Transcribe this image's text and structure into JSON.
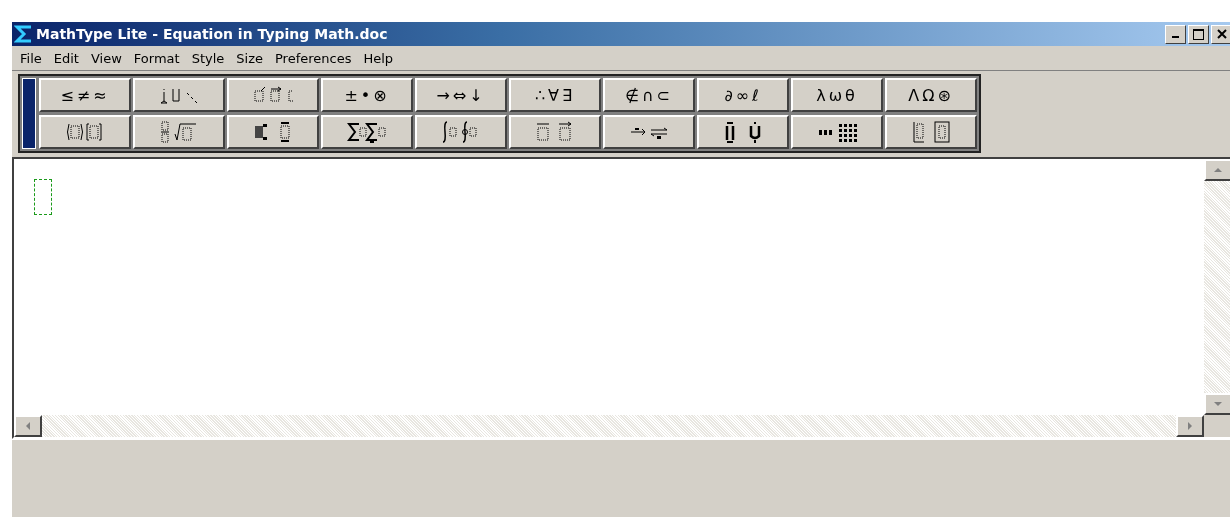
{
  "window": {
    "title": "MathType Lite - Equation in Typing Math.doc"
  },
  "menu": [
    "File",
    "Edit",
    "View",
    "Format",
    "Style",
    "Size",
    "Preferences",
    "Help"
  ],
  "symbol_palettes": [
    {
      "kind": "text",
      "label": "≤≠≈"
    },
    {
      "kind": "icon"
    },
    {
      "kind": "icon"
    },
    {
      "kind": "text",
      "label": "±•⊗"
    },
    {
      "kind": "text",
      "label": "→⇔↓"
    },
    {
      "kind": "text",
      "label": "∴∀∃"
    },
    {
      "kind": "text",
      "label": "∉∩⊂"
    },
    {
      "kind": "text",
      "label": "∂∞ℓ"
    },
    {
      "kind": "text",
      "label": "λωθ"
    },
    {
      "kind": "text",
      "label": "ΛΩ⊛"
    }
  ],
  "template_palettes": [
    {
      "kind": "icon"
    },
    {
      "kind": "icon"
    },
    {
      "kind": "icon"
    },
    {
      "kind": "icon"
    },
    {
      "kind": "icon"
    },
    {
      "kind": "icon"
    },
    {
      "kind": "icon"
    },
    {
      "kind": "icon"
    },
    {
      "kind": "icon"
    },
    {
      "kind": "icon"
    }
  ]
}
